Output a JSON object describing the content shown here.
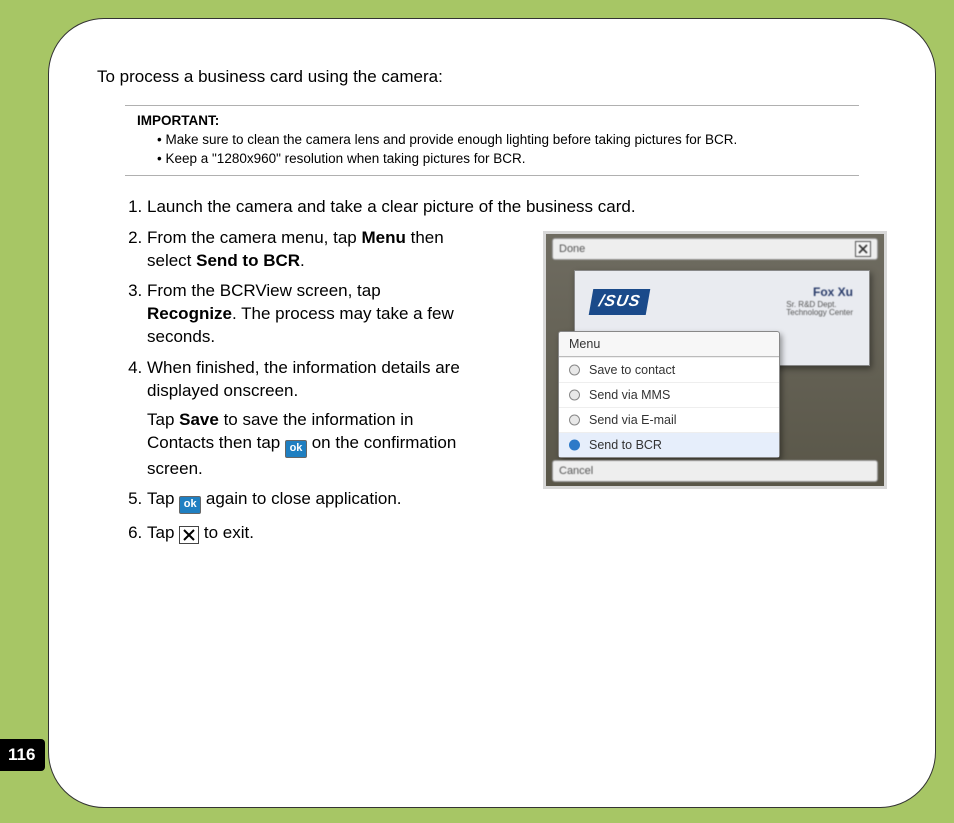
{
  "pageNumber": "116",
  "intro": "To process a business card using the camera:",
  "important": {
    "label": "IMPORTANT:",
    "b1": "• Make sure to clean the camera lens and provide enough lighting before taking pictures for BCR.",
    "b2": "• Keep a \"1280x960\" resolution when taking pictures for BCR."
  },
  "steps": {
    "s1": "Launch the camera and take a clear picture of the business card.",
    "s2a": "From the camera menu, tap ",
    "s2b": "Menu",
    "s2c": " then select ",
    "s2d": "Send to BCR",
    "s2e": ".",
    "s3a": "From the BCRView screen, tap ",
    "s3b": "Recognize",
    "s3c": ". The process may take a few seconds.",
    "s4a": "When finished, the information details are displayed onscreen.",
    "s4b": "Tap ",
    "s4c": "Save",
    "s4d": " to save the information in Contacts then tap ",
    "s4e": " on the confirmation screen.",
    "s5a": "Tap ",
    "s5b": " again to close application.",
    "s6a": "Tap ",
    "s6b": " to exit."
  },
  "okLabel": "ok",
  "screenshot": {
    "topLabel": "Done",
    "bottomLabel": "Cancel",
    "cardLogo": "/SUS",
    "cardName": "Fox Xu",
    "cardSub1": "Sr. R&D Dept.",
    "cardSub2": "Technology Center",
    "menuTitle": "Menu",
    "m1": "Save to contact",
    "m2": "Send via MMS",
    "m3": "Send via E-mail",
    "m4": "Send to BCR"
  }
}
